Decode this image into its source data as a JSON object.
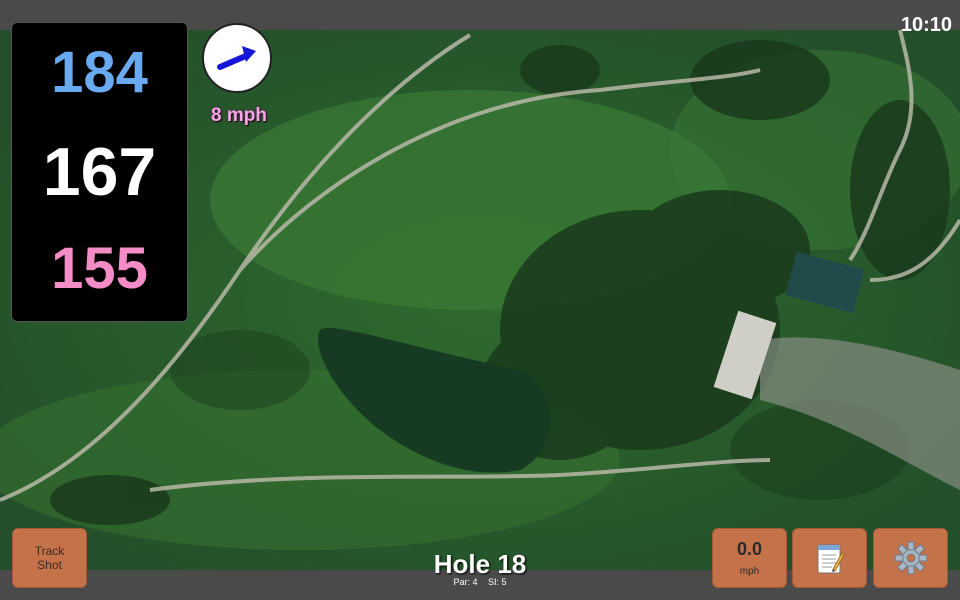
{
  "status": {
    "clock": "10:10"
  },
  "yardages": {
    "back": "184",
    "middle": "167",
    "front": "155"
  },
  "wind": {
    "speed_label": "8 mph",
    "direction_icon": "arrow-northeast-icon"
  },
  "hole": {
    "title": "Hole 18",
    "par_label": "Par: 4",
    "si_label": "SI: 5"
  },
  "buttons": {
    "track_shot_label": "Track\nShot",
    "speed_value": "0.0",
    "speed_unit": "mph",
    "notes_icon": "notepad-icon",
    "settings_icon": "gear-icon"
  },
  "colors": {
    "back_yardage": "#6aaaf0",
    "middle_yardage": "#ffffff",
    "front_yardage": "#f48cc6",
    "button_bg": "#c4724a",
    "wind_label": "#f6a6e6"
  }
}
